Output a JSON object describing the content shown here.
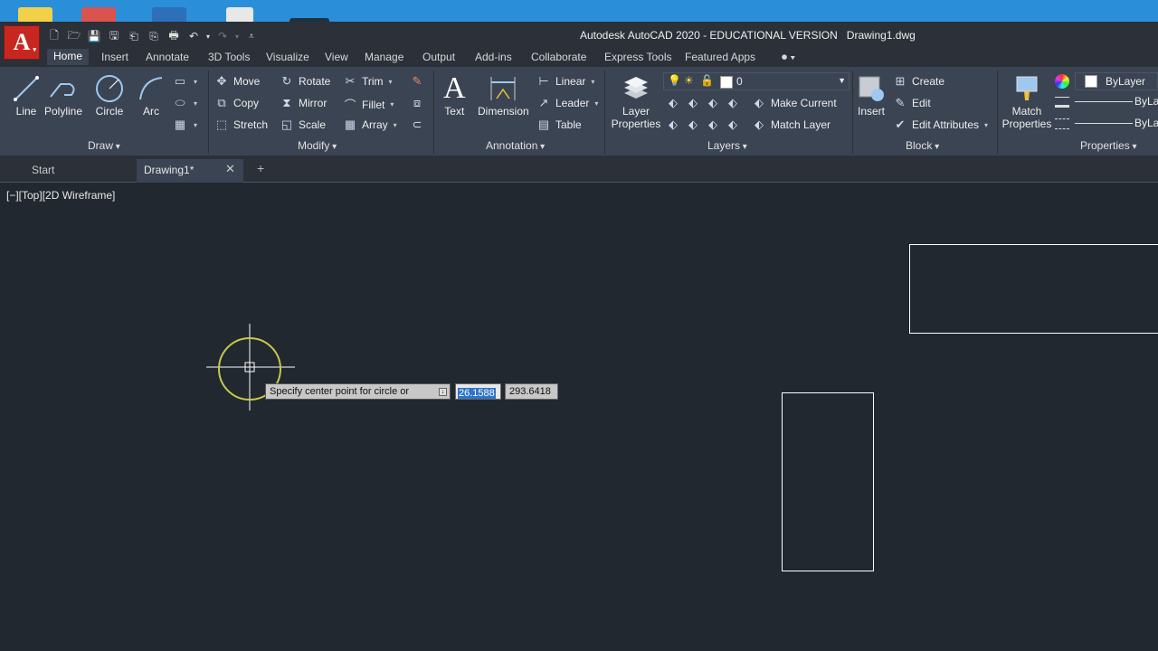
{
  "window": {
    "title": "Autodesk AutoCAD 2020 - EDUCATIONAL VERSION",
    "document": "Drawing1.dwg"
  },
  "app_button": {
    "letter": "A"
  },
  "ribbon_tabs": [
    "Home",
    "Insert",
    "Annotate",
    "3D Tools",
    "Visualize",
    "View",
    "Manage",
    "Output",
    "Add-ins",
    "Collaborate",
    "Express Tools",
    "Featured Apps"
  ],
  "draw": {
    "title": "Draw",
    "line": "Line",
    "polyline": "Polyline",
    "circle": "Circle",
    "arc": "Arc"
  },
  "modify": {
    "title": "Modify",
    "move": "Move",
    "rotate": "Rotate",
    "trim": "Trim",
    "copy": "Copy",
    "mirror": "Mirror",
    "fillet": "Fillet",
    "stretch": "Stretch",
    "scale": "Scale",
    "array": "Array"
  },
  "annotation": {
    "title": "Annotation",
    "text": "Text",
    "dimension": "Dimension",
    "linear": "Linear",
    "leader": "Leader",
    "table": "Table"
  },
  "layers": {
    "title": "Layers",
    "layer_properties": "Layer Properties",
    "current_layer": "0",
    "make_current": "Make Current",
    "match_layer": "Match Layer"
  },
  "block": {
    "title": "Block",
    "insert": "Insert",
    "create": "Create",
    "edit": "Edit",
    "edit_attributes": "Edit Attributes"
  },
  "properties": {
    "title": "Properties",
    "match_properties": "Match Properties",
    "color": "ByLayer",
    "linetype": "ByLa",
    "lineweight": "ByLa"
  },
  "doc_tabs": {
    "start": "Start",
    "drawing": "Drawing1*"
  },
  "viewport": {
    "label": "[−][Top][2D Wireframe]"
  },
  "command": {
    "prompt": "Specify center point for circle or",
    "x_value": "26.1588",
    "y_value": "293.6418"
  },
  "colors": {
    "canvas": "#212830",
    "ribbon": "#3b4452",
    "accent_red": "#c8271f",
    "cursor_ring": "#c8c84a"
  }
}
